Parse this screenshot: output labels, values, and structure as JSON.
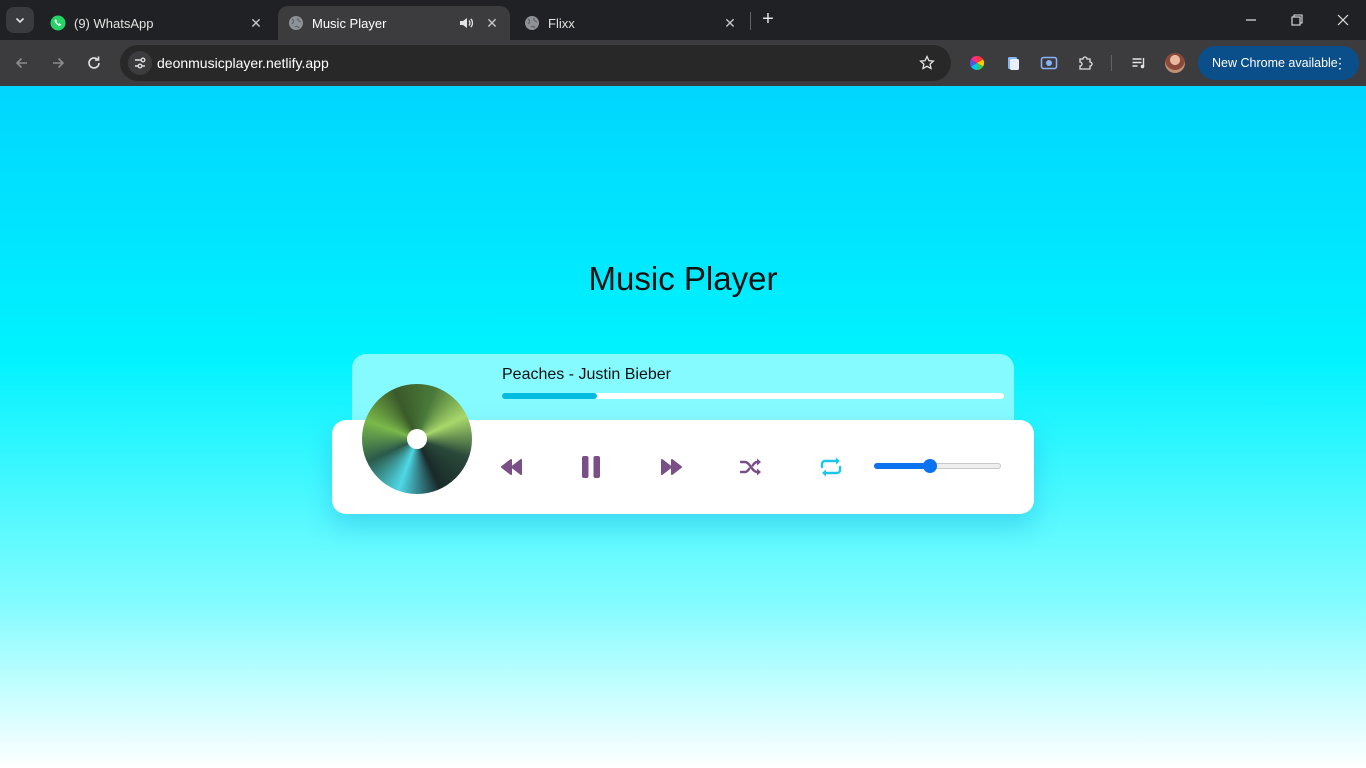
{
  "browser": {
    "tabs": [
      {
        "title": "(9) WhatsApp",
        "icon": "whatsapp-icon",
        "active": false
      },
      {
        "title": "Music Player",
        "icon": "globe-icon",
        "active": true,
        "audio": true
      },
      {
        "title": "Flixx",
        "icon": "globe-icon",
        "active": false
      }
    ],
    "url": "deonmusicplayer.netlify.app",
    "update_button": "New Chrome available"
  },
  "page": {
    "title": "Music Player",
    "player": {
      "song": "Peaches - Justin Bieber",
      "progress": 0.19,
      "volume": 0.44,
      "repeat_active": true,
      "is_playing": true
    }
  },
  "colors": {
    "accent_purple": "#7a4f87",
    "accent_cyan": "#1cc6ea",
    "progress": "#00bde0",
    "volume": "#0b72f0",
    "update_button_bg": "#0b4f8a"
  }
}
